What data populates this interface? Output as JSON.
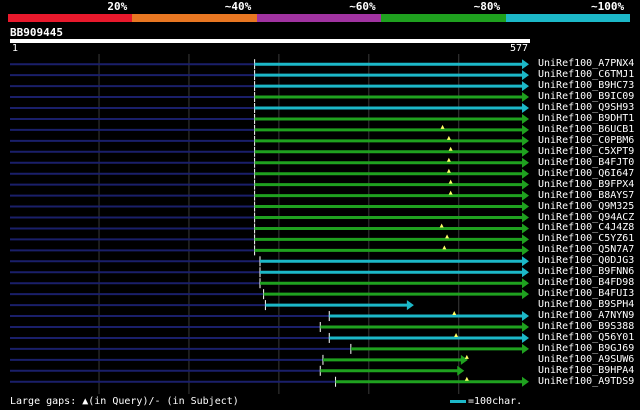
{
  "identity_legend": [
    {
      "label": "20%",
      "color": "#e8192c"
    },
    {
      "label": "~40%",
      "color": "#e87722"
    },
    {
      "label": "~60%",
      "color": "#a133a1"
    },
    {
      "label": "~80%",
      "color": "#1fa11f"
    },
    {
      "label": "~100%",
      "color": "#1cb8c8"
    }
  ],
  "query": {
    "id": "BB909445",
    "start": "1",
    "end": "577",
    "length": 577
  },
  "hits": [
    {
      "name": "UniRef100_A7PNX4",
      "qstart": 273,
      "qend": 577,
      "color": "#1cb8c8",
      "gap_at": null
    },
    {
      "name": "UniRef100_C6TMJ1",
      "qstart": 273,
      "qend": 577,
      "color": "#1cb8c8",
      "gap_at": null
    },
    {
      "name": "UniRef100_B9HC73",
      "qstart": 273,
      "qend": 577,
      "color": "#1cb8c8",
      "gap_at": null
    },
    {
      "name": "UniRef100_B9IC09",
      "qstart": 273,
      "qend": 577,
      "color": "#1fa11f",
      "gap_at": null
    },
    {
      "name": "UniRef100_Q9SH93",
      "qstart": 273,
      "qend": 577,
      "color": "#1cb8c8",
      "gap_at": null
    },
    {
      "name": "UniRef100_B9DHT1",
      "qstart": 273,
      "qend": 577,
      "color": "#1fa11f",
      "gap_at": null
    },
    {
      "name": "UniRef100_B6UCB1",
      "qstart": 273,
      "qend": 577,
      "color": "#1fa11f",
      "gap_at": 482
    },
    {
      "name": "UniRef100_C0PBM6",
      "qstart": 273,
      "qend": 577,
      "color": "#1fa11f",
      "gap_at": 489
    },
    {
      "name": "UniRef100_C5XPT9",
      "qstart": 273,
      "qend": 577,
      "color": "#1fa11f",
      "gap_at": 491
    },
    {
      "name": "UniRef100_B4FJT0",
      "qstart": 273,
      "qend": 577,
      "color": "#1fa11f",
      "gap_at": 489
    },
    {
      "name": "UniRef100_Q6I647",
      "qstart": 273,
      "qend": 577,
      "color": "#1fa11f",
      "gap_at": 489
    },
    {
      "name": "UniRef100_B9FPX4",
      "qstart": 273,
      "qend": 577,
      "color": "#1fa11f",
      "gap_at": 491
    },
    {
      "name": "UniRef100_B8AYS7",
      "qstart": 273,
      "qend": 577,
      "color": "#1fa11f",
      "gap_at": 491
    },
    {
      "name": "UniRef100_Q9M325",
      "qstart": 273,
      "qend": 577,
      "color": "#1fa11f",
      "gap_at": null
    },
    {
      "name": "UniRef100_Q94ACZ",
      "qstart": 273,
      "qend": 577,
      "color": "#1fa11f",
      "gap_at": null
    },
    {
      "name": "UniRef100_C4J4Z8",
      "qstart": 273,
      "qend": 577,
      "color": "#1fa11f",
      "gap_at": 481
    },
    {
      "name": "UniRef100_C5YZ61",
      "qstart": 273,
      "qend": 577,
      "color": "#1fa11f",
      "gap_at": 487
    },
    {
      "name": "UniRef100_Q5N7A7",
      "qstart": 273,
      "qend": 577,
      "color": "#1fa11f",
      "gap_at": 484
    },
    {
      "name": "UniRef100_Q0DJG3",
      "qstart": 279,
      "qend": 577,
      "color": "#1cb8c8",
      "gap_at": null
    },
    {
      "name": "UniRef100_B9FNN6",
      "qstart": 279,
      "qend": 577,
      "color": "#1cb8c8",
      "gap_at": null
    },
    {
      "name": "UniRef100_B4FD98",
      "qstart": 279,
      "qend": 577,
      "color": "#1fa11f",
      "gap_at": null
    },
    {
      "name": "UniRef100_B4FUI3",
      "qstart": 283,
      "qend": 577,
      "color": "#1fa11f",
      "gap_at": null
    },
    {
      "name": "UniRef100_B9SPH4",
      "qstart": 285,
      "qend": 449,
      "color": "#1cb8c8",
      "gap_at": null
    },
    {
      "name": "UniRef100_A7NYN9",
      "qstart": 356,
      "qend": 577,
      "color": "#1cb8c8",
      "gap_at": 495
    },
    {
      "name": "UniRef100_B9S388",
      "qstart": 346,
      "qend": 577,
      "color": "#1fa11f",
      "gap_at": null
    },
    {
      "name": "UniRef100_Q56Y01",
      "qstart": 356,
      "qend": 577,
      "color": "#1cb8c8",
      "gap_at": 497
    },
    {
      "name": "UniRef100_B9GJ69",
      "qstart": 380,
      "qend": 577,
      "color": "#1fa11f",
      "gap_at": null
    },
    {
      "name": "UniRef100_A9SUW6",
      "qstart": 349,
      "qend": 509,
      "color": "#1fa11f",
      "gap_at": 509
    },
    {
      "name": "UniRef100_B9HPA4",
      "qstart": 346,
      "qend": 505,
      "color": "#1fa11f",
      "gap_at": null
    },
    {
      "name": "UniRef100_A9TDS9",
      "qstart": 363,
      "qend": 577,
      "color": "#1fa11f",
      "gap_at": 509
    }
  ],
  "footer": {
    "gaps_text": "Large gaps: ▲(in Query)/- (in Subject)",
    "scale_text": "=100char.",
    "scale_color": "#1cb8c8"
  }
}
